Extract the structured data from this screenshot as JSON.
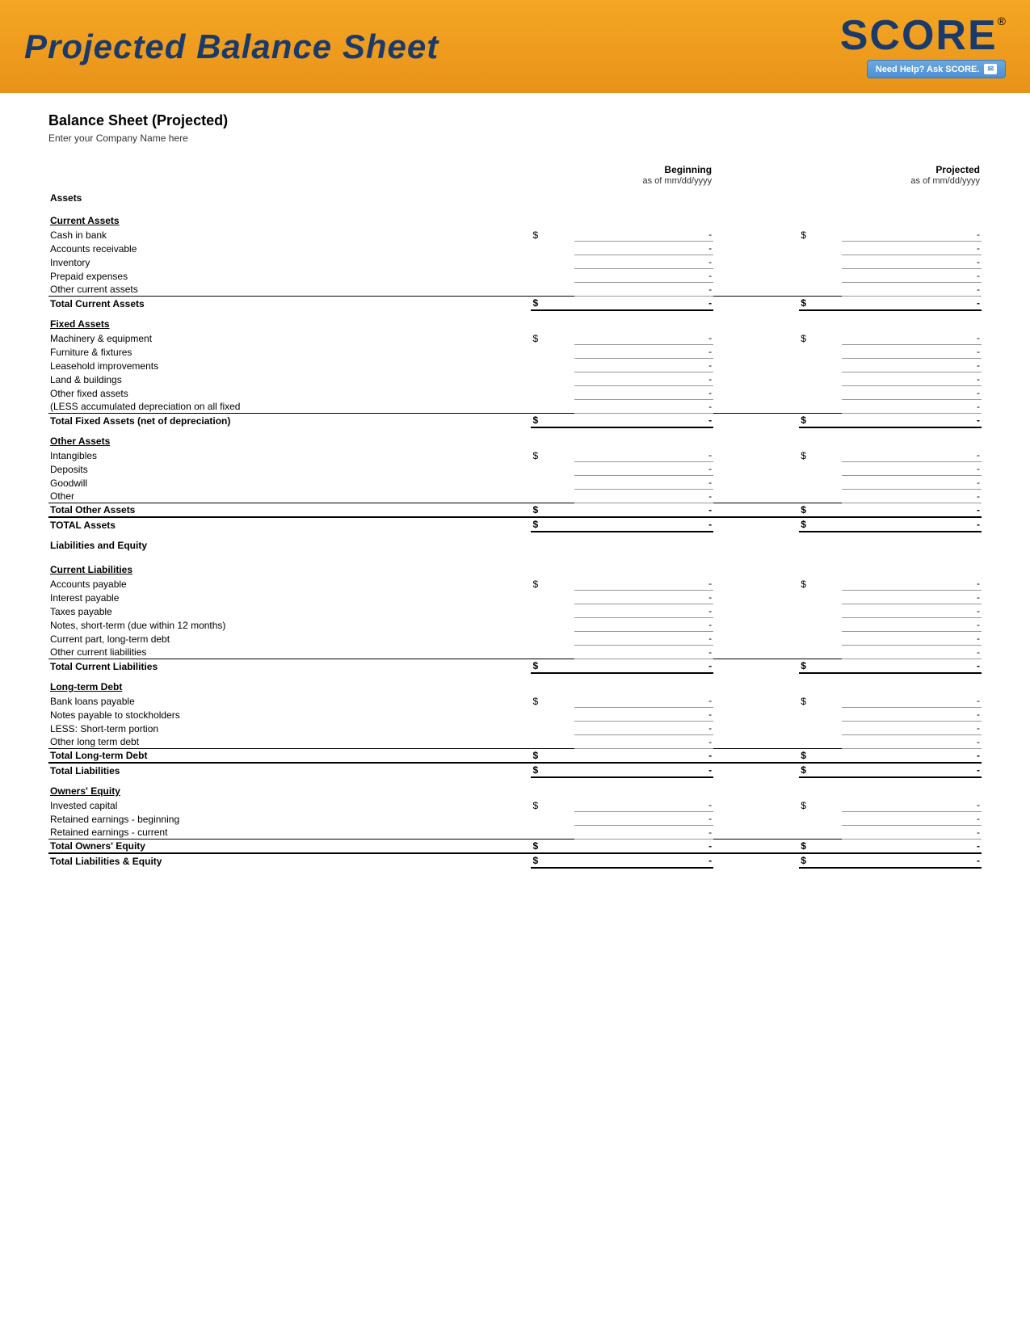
{
  "header": {
    "title": "Projected Balance Sheet",
    "score_text": "SCORE",
    "score_registered": "®",
    "help_text": "Need Help? Ask SCORE.",
    "email_icon": "✉"
  },
  "page": {
    "title": "Balance Sheet (Projected)",
    "company_name": "Enter your Company Name here"
  },
  "columns": {
    "beginning_label": "Beginning",
    "beginning_date": "as of mm/dd/yyyy",
    "projected_label": "Projected",
    "projected_date": "as of mm/dd/yyyy"
  },
  "assets_label": "Assets",
  "sections": {
    "current_assets": {
      "header": "Current Assets",
      "items": [
        {
          "label": "Cash in bank",
          "show_dollar": true
        },
        {
          "label": "Accounts receivable",
          "show_dollar": false
        },
        {
          "label": "Inventory",
          "show_dollar": false
        },
        {
          "label": "Prepaid expenses",
          "show_dollar": false
        },
        {
          "label": "Other current assets",
          "show_dollar": false
        }
      ],
      "total_label": "Total Current Assets",
      "value": "-"
    },
    "fixed_assets": {
      "header": "Fixed Assets",
      "items": [
        {
          "label": "Machinery & equipment",
          "show_dollar": true
        },
        {
          "label": "Furniture & fixtures",
          "show_dollar": false
        },
        {
          "label": "Leasehold improvements",
          "show_dollar": false
        },
        {
          "label": "Land & buildings",
          "show_dollar": false
        },
        {
          "label": "Other fixed assets",
          "show_dollar": false
        },
        {
          "label": "(LESS accumulated depreciation on all fixed",
          "show_dollar": false
        }
      ],
      "total_label": "Total Fixed Assets (net of depreciation)",
      "value": "-"
    },
    "other_assets": {
      "header": "Other Assets",
      "items": [
        {
          "label": "Intangibles",
          "show_dollar": true
        },
        {
          "label": "Deposits",
          "show_dollar": false
        },
        {
          "label": "Goodwill",
          "show_dollar": false
        },
        {
          "label": "Other",
          "show_dollar": false
        }
      ],
      "total_label": "Total Other Assets",
      "value": "-"
    },
    "total_assets": {
      "label": "TOTAL Assets",
      "value": "-"
    },
    "liabilities_equity_header": "Liabilities and Equity",
    "current_liabilities": {
      "header": "Current Liabilities",
      "items": [
        {
          "label": "Accounts payable",
          "show_dollar": true
        },
        {
          "label": "Interest payable",
          "show_dollar": false
        },
        {
          "label": "Taxes payable",
          "show_dollar": false
        },
        {
          "label": "Notes, short-term (due within 12 months)",
          "show_dollar": false
        },
        {
          "label": "Current part, long-term debt",
          "show_dollar": false
        },
        {
          "label": "Other current liabilities",
          "show_dollar": false
        }
      ],
      "total_label": "Total Current Liabilities",
      "value": "-"
    },
    "long_term_debt": {
      "header": "Long-term Debt",
      "items": [
        {
          "label": "Bank loans payable",
          "show_dollar": true
        },
        {
          "label": "Notes payable to stockholders",
          "show_dollar": false
        },
        {
          "label": "LESS: Short-term portion",
          "show_dollar": false
        },
        {
          "label": "Other long term debt",
          "show_dollar": false
        }
      ],
      "total_label": "Total Long-term Debt",
      "value": "-"
    },
    "total_liabilities": {
      "label": "Total Liabilities",
      "value": "-"
    },
    "owners_equity": {
      "header": "Owners' Equity",
      "items": [
        {
          "label": "Invested capital",
          "show_dollar": true
        },
        {
          "label": "Retained earnings - beginning",
          "show_dollar": false
        },
        {
          "label": "Retained earnings - current",
          "show_dollar": false
        }
      ],
      "total_label": "Total Owners' Equity",
      "value": "-"
    },
    "total_liabilities_equity": {
      "label": "Total Liabilities & Equity",
      "value": "-"
    }
  },
  "dash": "-",
  "dollar": "$"
}
